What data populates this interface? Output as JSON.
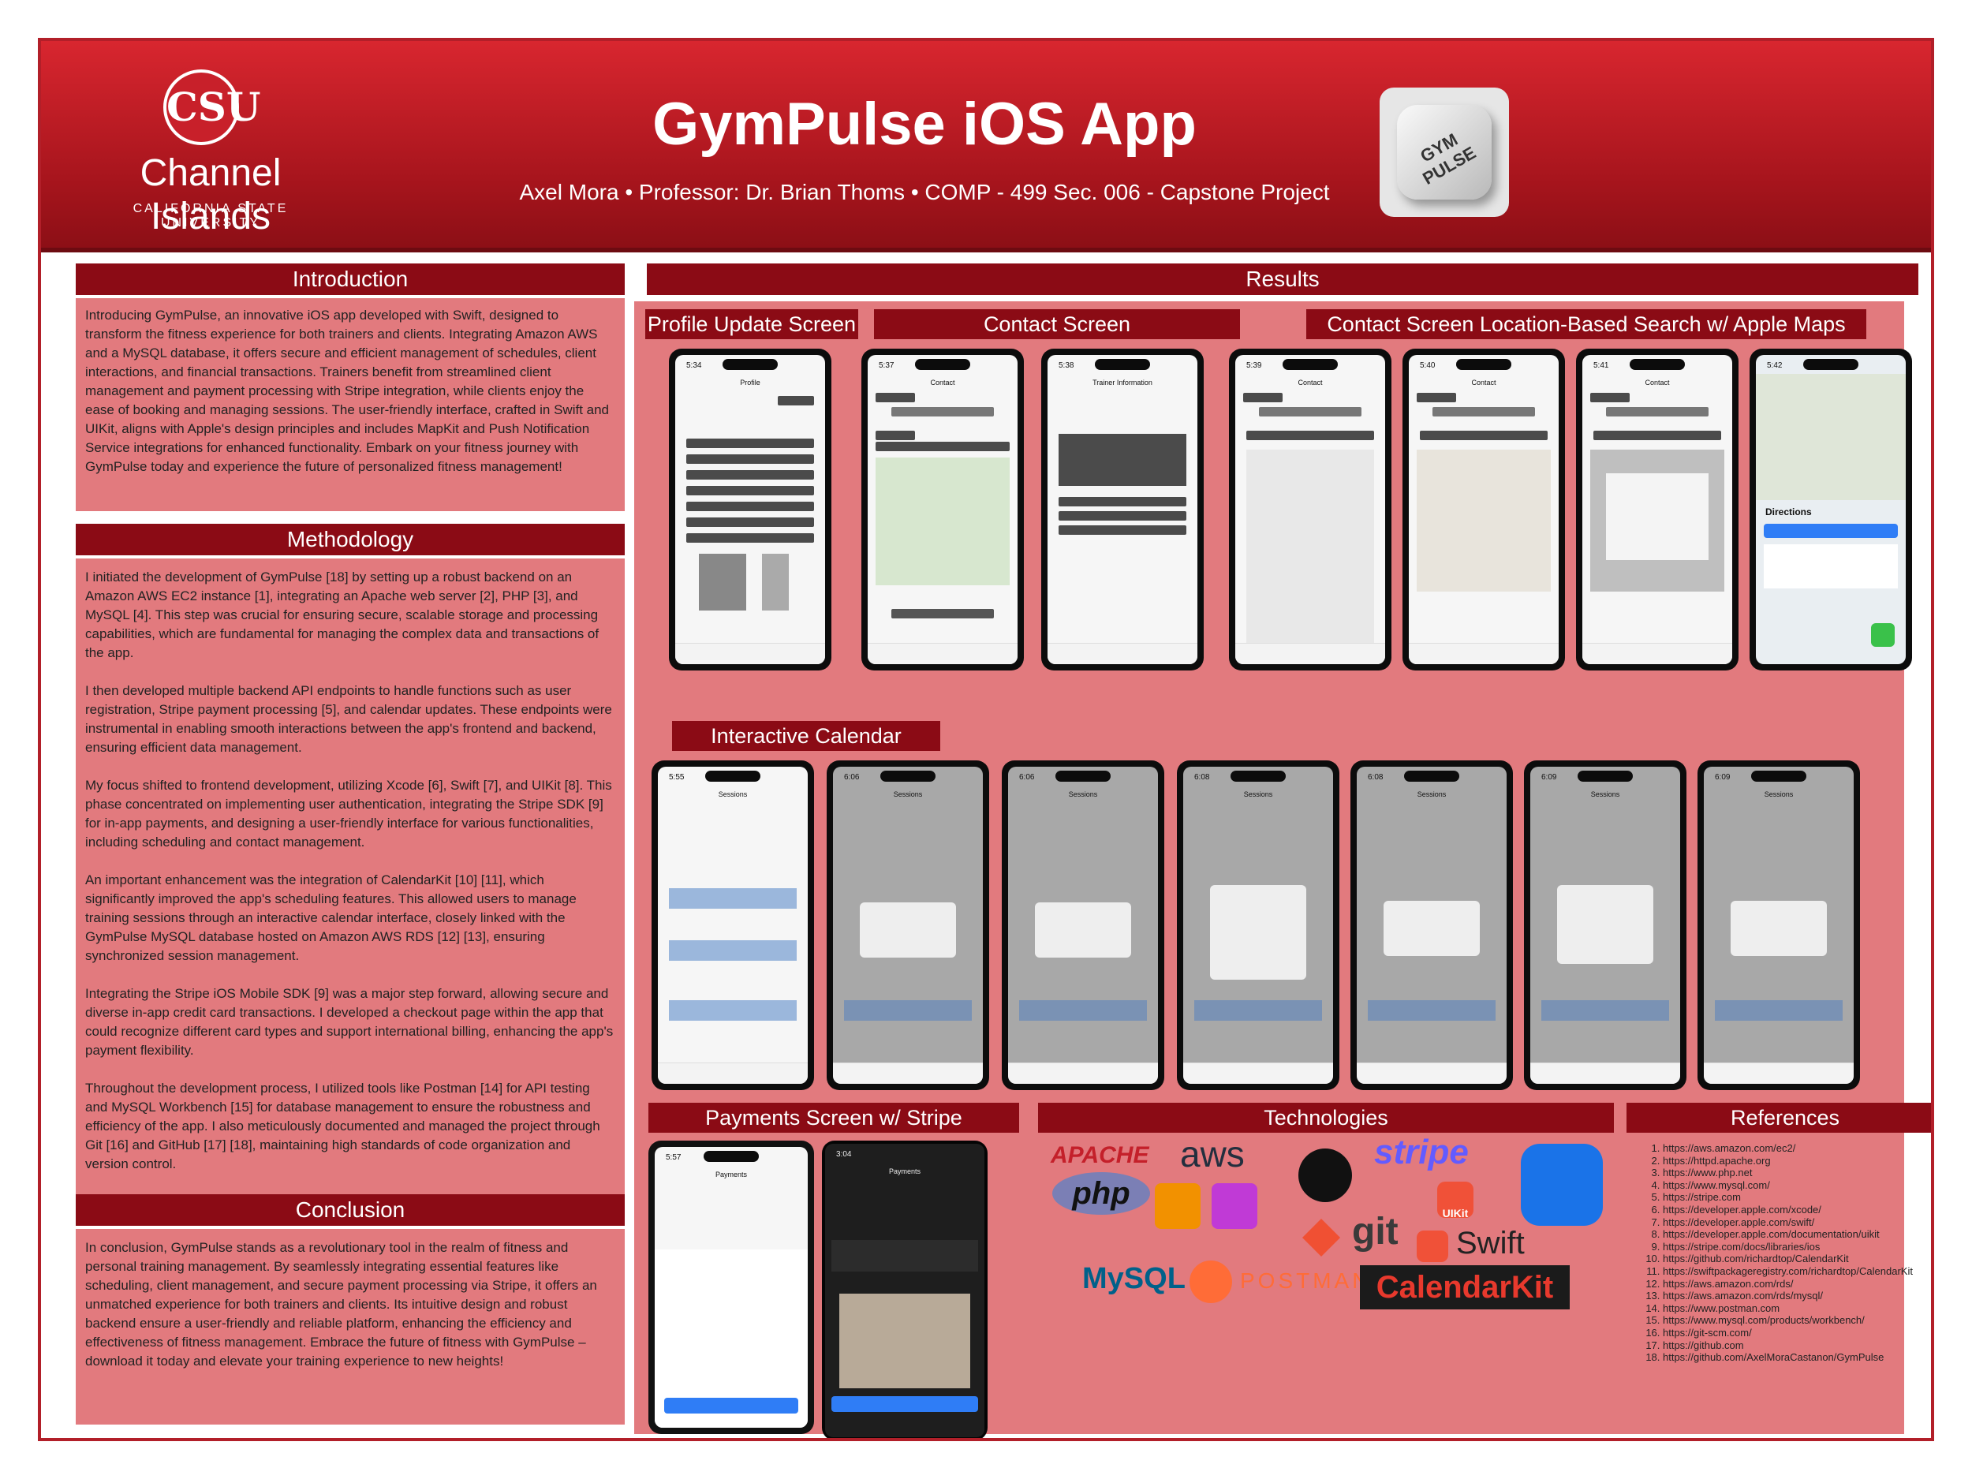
{
  "header": {
    "logo_name": "Channel Islands",
    "logo_sub": "CALIFORNIA STATE UNIVERSITY",
    "logo_mark": "CSU",
    "title": "GymPulse iOS App",
    "subtitle": "Axel Mora • Professor: Dr. Brian Thoms • COMP - 499 Sec. 006 - Capstone Project",
    "app_icon_label": "GYM PULSE"
  },
  "introduction": {
    "heading": "Introduction",
    "body": "Introducing GymPulse, an innovative iOS app developed with Swift, designed to transform the fitness experience for both trainers and clients. Integrating Amazon AWS and a MySQL database, it offers secure and efficient management of schedules, client interactions, and financial transactions. Trainers benefit from streamlined client management and payment processing with Stripe integration, while clients enjoy the ease of booking and managing sessions. The user-friendly interface, crafted in Swift and UIKit, aligns with Apple's design principles and includes MapKit and Push Notification Service integrations for enhanced functionality. Embark on your fitness journey with GymPulse today and experience the future of personalized fitness management!"
  },
  "methodology": {
    "heading": "Methodology",
    "paragraphs": [
      "I initiated the development of GymPulse [18] by setting up a robust backend on an Amazon AWS EC2 instance [1], integrating an Apache web server [2], PHP [3], and MySQL [4]. This step was crucial for ensuring secure, scalable storage and processing capabilities, which are fundamental for managing the complex data and transactions of the app.",
      "I then developed multiple backend API endpoints to handle functions such as user registration, Stripe payment processing [5], and calendar updates. These endpoints were instrumental in enabling smooth interactions between the app's frontend and backend, ensuring efficient data management.",
      "My focus shifted to frontend development, utilizing Xcode [6], Swift [7], and UIKit [8]. This phase concentrated on implementing user authentication, integrating the Stripe SDK [9] for in-app payments, and designing a user-friendly interface for various functionalities, including scheduling and contact management.",
      "An important enhancement was the integration of CalendarKit [10] [11], which significantly improved the app's scheduling features. This allowed users to manage training sessions through an interactive calendar interface, closely linked with the GymPulse MySQL database hosted on Amazon AWS RDS [12] [13], ensuring synchronized session management.",
      "Integrating the Stripe iOS Mobile SDK [9] was a major step forward, allowing secure and diverse in-app credit card transactions. I developed a checkout page within the app that could recognize different card types and support international billing, enhancing the app's payment flexibility.",
      "Throughout the development process, I utilized tools like Postman [14] for API testing and MySQL Workbench [15] for database management to ensure the robustness and efficiency of the app. I also meticulously documented and managed the project through Git [16] and GitHub [17] [18], maintaining high standards of code organization and version control."
    ]
  },
  "conclusion": {
    "heading": "Conclusion",
    "body": "In conclusion, GymPulse stands as a revolutionary tool in the realm of fitness and personal training management. By seamlessly integrating essential features like scheduling, client management, and secure payment processing via Stripe, it offers an unmatched experience for both trainers and clients. Its intuitive design and robust backend ensure a user-friendly and reliable platform, enhancing the efficiency and effectiveness of fitness management. Embrace the future of fitness with GymPulse – download it today and elevate your training experience to new heights!"
  },
  "results": {
    "heading": "Results",
    "profile_heading": "Profile Update Screen",
    "contact_heading": "Contact Screen",
    "location_heading": "Contact Screen Location-Based Search w/ Apple Maps",
    "calendar_heading": "Interactive Calendar",
    "payments_heading": "Payments Screen w/ Stripe",
    "technologies_heading": "Technologies",
    "references_heading": "References"
  },
  "screens": {
    "profile": {
      "time": "5:34",
      "title": "Profile"
    },
    "contact1": {
      "time": "5:37",
      "title": "Contact"
    },
    "contact2": {
      "time": "5:38",
      "title": "Trainer Information"
    },
    "loc1": {
      "time": "5:39",
      "title": "Contact"
    },
    "loc2": {
      "time": "5:40",
      "title": "Contact"
    },
    "loc3": {
      "time": "5:41",
      "title": "Contact"
    },
    "loc4": {
      "time": "5:42",
      "title": "Directions"
    },
    "cal1": {
      "time": "5:55",
      "title": "Sessions"
    },
    "cal2": {
      "time": "6:06",
      "title": "Sessions"
    },
    "cal3": {
      "time": "6:06",
      "title": "Sessions"
    },
    "cal4": {
      "time": "6:08",
      "title": "Sessions"
    },
    "cal5": {
      "time": "6:08",
      "title": "Sessions"
    },
    "cal6": {
      "time": "6:09",
      "title": "Sessions"
    },
    "cal7": {
      "time": "6:09",
      "title": "Sessions"
    },
    "pay1": {
      "time": "5:57",
      "title": "Payments"
    },
    "pay2": {
      "time": "3:04",
      "title": "Payments"
    }
  },
  "technologies": {
    "apache": "APACHE",
    "aws": "aws",
    "stripe": "stripe",
    "php": "php",
    "git": "git",
    "uikit": "UIKit",
    "swift": "Swift",
    "mysql": "MySQL",
    "postman": "POSTMAN",
    "calendarkit": "CalendarKit"
  },
  "references": [
    "https://aws.amazon.com/ec2/",
    "https://httpd.apache.org",
    "https://www.php.net",
    "https://www.mysql.com/",
    "https://stripe.com",
    "https://developer.apple.com/xcode/",
    "https://developer.apple.com/swift/",
    "https://developer.apple.com/documentation/uikit",
    "https://stripe.com/docs/libraries/ios",
    "https://github.com/richardtop/CalendarKit",
    "https://swiftpackageregistry.com/richardtop/CalendarKit",
    "https://aws.amazon.com/rds/",
    "https://aws.amazon.com/rds/mysql/",
    "https://www.postman.com",
    "https://www.mysql.com/products/workbench/",
    "https://git-scm.com/",
    "https://github.com",
    "https://github.com/AxelMoraCastanon/GymPulse"
  ],
  "colors": {
    "primary": "#a5141c",
    "section_header": "#8b0b15",
    "panel": "#e27a7e"
  }
}
